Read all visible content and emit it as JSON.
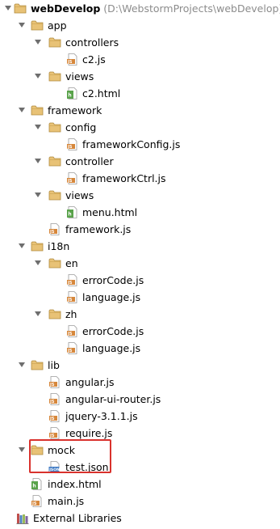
{
  "project": {
    "root_name": "webDevelop",
    "root_path": "(D:\\WebstormProjects\\webDevelop)"
  },
  "tree": {
    "app": "app",
    "app_controllers": "controllers",
    "app_controllers_c2js": "c2.js",
    "app_views": "views",
    "app_views_c2html": "c2.html",
    "framework": "framework",
    "framework_config": "config",
    "framework_config_file": "frameworkConfig.js",
    "framework_controller": "controller",
    "framework_controller_file": "frameworkCtrl.js",
    "framework_views": "views",
    "framework_views_menu": "menu.html",
    "framework_js": "framework.js",
    "i18n": "i18n",
    "i18n_en": "en",
    "i18n_en_errorcode": "errorCode.js",
    "i18n_en_language": "language.js",
    "i18n_zh": "zh",
    "i18n_zh_errorcode": "errorCode.js",
    "i18n_zh_language": "language.js",
    "lib": "lib",
    "lib_angular": "angular.js",
    "lib_angular_ui_router": "angular-ui-router.js",
    "lib_jquery": "jquery-3.1.1.js",
    "lib_require": "require.js",
    "mock": "mock",
    "mock_test": "test.json",
    "index_html": "index.html",
    "main_js": "main.js",
    "external_libraries": "External Libraries"
  },
  "icons": {
    "folder": "folder-icon",
    "js_file": "js-file-icon",
    "html_file": "html-file-icon",
    "json_file": "json-file-icon",
    "external_libraries": "external-libraries-icon",
    "expand_arrow": "chevron-down-icon"
  },
  "colors": {
    "folder": "#e8c276",
    "folder_dark": "#c9a14f",
    "js_badge": "#d6873b",
    "html_badge": "#5aa34b",
    "json_badge": "#3a77c2",
    "highlight": "#d9322d",
    "path_hint": "#8c8c8c"
  }
}
